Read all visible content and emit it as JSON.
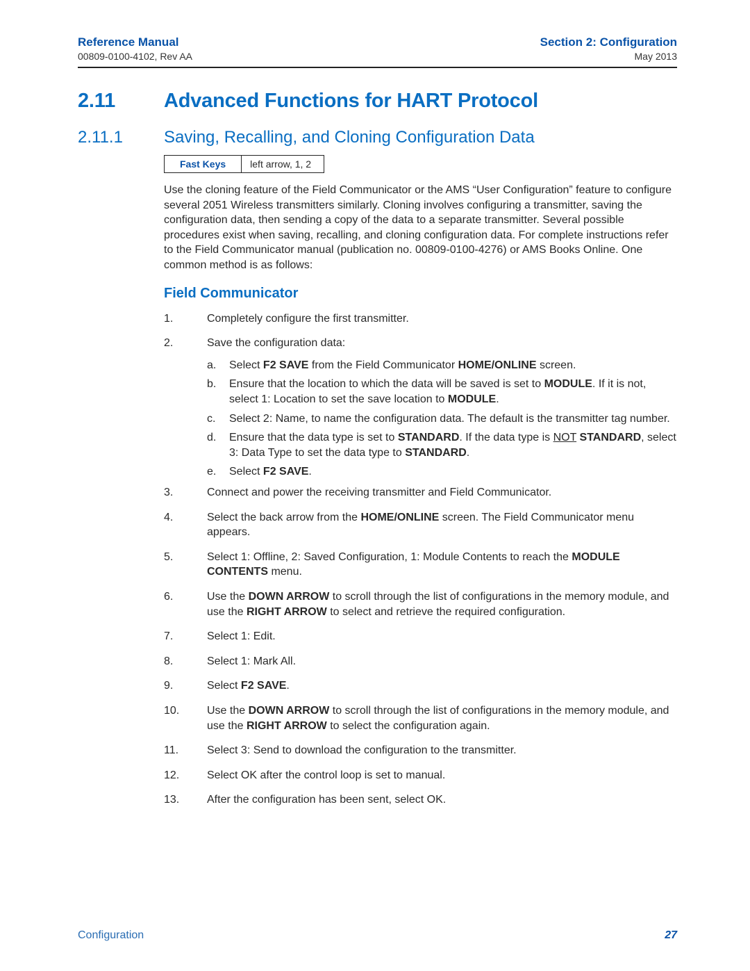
{
  "header": {
    "left_title": "Reference Manual",
    "left_sub": "00809-0100-4102, Rev AA",
    "right_title": "Section 2: Configuration",
    "right_sub": "May 2013"
  },
  "section": {
    "num": "2.11",
    "title": "Advanced Functions for HART Protocol"
  },
  "subsection": {
    "num": "2.11.1",
    "title": "Saving, Recalling, and Cloning Configuration Data"
  },
  "fastkeys": {
    "label": "Fast Keys",
    "value": "left arrow, 1, 2"
  },
  "intro_para": "Use the cloning feature of the Field Communicator or the AMS “User Configuration” feature to configure several 2051 Wireless transmitters similarly. Cloning involves configuring a transmitter, saving the configuration data, then sending a copy of the data to a separate transmitter. Several possible procedures exist when saving, recalling, and cloning configuration data. For complete instructions refer to the Field Communicator manual (publication no. 00809-0100-4276) or AMS Books Online. One common method is as follows:",
  "h3": "Field Communicator",
  "steps": {
    "1": {
      "num": "1.",
      "text": "Completely configure the first transmitter."
    },
    "2": {
      "num": "2.",
      "text": "Save the configuration data:"
    },
    "2a": {
      "letter": "a.",
      "pre": "Select ",
      "b1": "F2 SAVE",
      "mid": " from the Field Communicator ",
      "b2": "HOME/ONLINE",
      "post": " screen."
    },
    "2b": {
      "letter": "b.",
      "pre": "Ensure that the location to which the data will be saved is set to ",
      "b1": "MODULE",
      "mid": ". If it is not, select 1: Location to set the save location to ",
      "b2": "MODULE",
      "post": "."
    },
    "2c": {
      "letter": "c.",
      "text": "Select 2: Name, to name the configuration data. The default is the transmitter tag number."
    },
    "2d": {
      "letter": "d.",
      "pre": "Ensure that the data type is set to ",
      "b1": "STANDARD",
      "mid1": ". If the data type is ",
      "not": "NOT",
      "space": " ",
      "b2": "STANDARD",
      "mid2": ", select 3: Data Type to set the data type to ",
      "b3": "STANDARD",
      "post": "."
    },
    "2e": {
      "letter": "e.",
      "pre": "Select ",
      "b1": "F2 SAVE",
      "post": "."
    },
    "3": {
      "num": "3.",
      "text": "Connect and power the receiving transmitter and Field Communicator."
    },
    "4": {
      "num": "4.",
      "pre": "Select the back arrow from the ",
      "b1": "HOME/ONLINE",
      "post": " screen. The Field Communicator menu appears."
    },
    "5": {
      "num": "5.",
      "pre": "Select 1: Offline, 2: Saved Configuration, 1: Module Contents to reach the ",
      "b1": "MODULE CONTENTS",
      "post": " menu."
    },
    "6": {
      "num": "6.",
      "pre": "Use the ",
      "b1": "DOWN ARROW",
      "mid": " to scroll through the list of configurations in the memory module, and use the ",
      "b2": "RIGHT ARROW",
      "post": " to select and retrieve the required configuration."
    },
    "7": {
      "num": "7.",
      "text": "Select 1: Edit."
    },
    "8": {
      "num": "8.",
      "text": "Select 1: Mark All."
    },
    "9": {
      "num": "9.",
      "pre": "Select ",
      "b1": "F2 SAVE",
      "post": "."
    },
    "10": {
      "num": "10.",
      "pre": "Use the ",
      "b1": "DOWN ARROW",
      "mid": " to scroll through the list of configurations in the memory module, and use the ",
      "b2": "RIGHT ARROW",
      "post": " to select the configuration again."
    },
    "11": {
      "num": "11.",
      "text": "Select 3: Send to download the configuration to the transmitter."
    },
    "12": {
      "num": "12.",
      "text": "Select OK after the control loop is set to manual."
    },
    "13": {
      "num": "13.",
      "text": "After the configuration has been sent, select OK."
    }
  },
  "footer": {
    "left": "Configuration",
    "right": "27"
  }
}
